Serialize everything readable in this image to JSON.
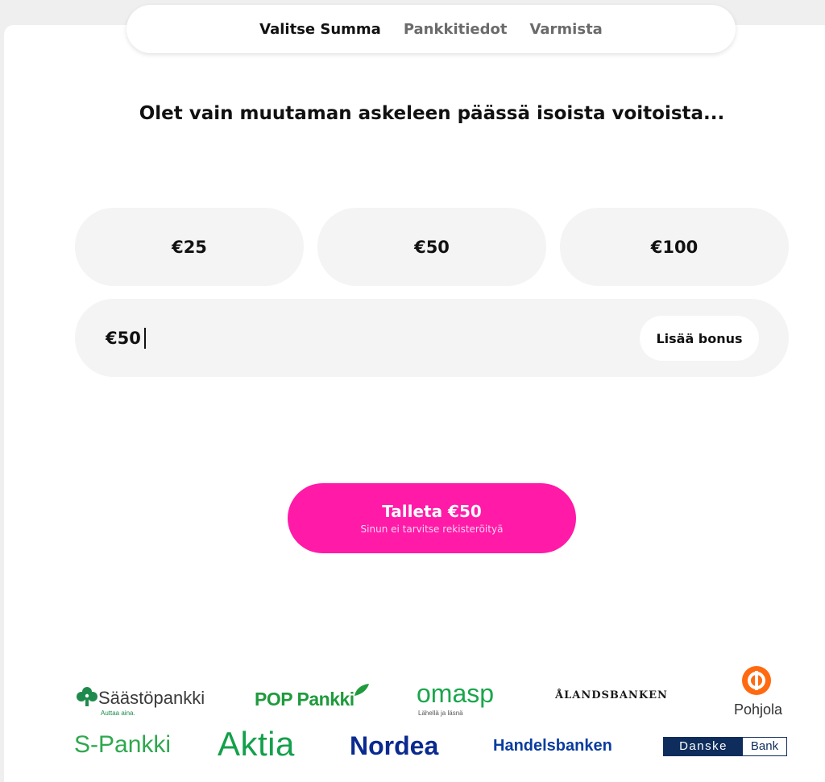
{
  "steps": [
    "Valitse Summa",
    "Pankkitiedot",
    "Varmista"
  ],
  "headline": "Olet vain muutaman askeleen päässä isoista voitoista...",
  "amount_options": [
    "€25",
    "€50",
    "€100"
  ],
  "amount_input": {
    "value": "€50"
  },
  "bonus_button": "Lisää bonus",
  "deposit_button": {
    "label": "Talleta €50",
    "sublabel": "Sinun ei tarvitse rekisteröityä"
  },
  "banks": {
    "saastopankki": {
      "name": "Säästöpankki",
      "tagline": "Auttaa aina."
    },
    "poppankki": {
      "name": "POP Pankki"
    },
    "omasp": {
      "name": "omasp",
      "tagline": "Lähellä ja läsnä"
    },
    "alandsbanken": {
      "name": "ÅLANDSBANKEN"
    },
    "pohjola": {
      "name": "Pohjola"
    },
    "spankki": {
      "name": "S-Pankki"
    },
    "aktia": {
      "name": "Aktia"
    },
    "nordea": {
      "name": "Nordea"
    },
    "handelsbanken": {
      "name": "Handelsbanken"
    },
    "danske": {
      "part1": "Danske",
      "part2": "Bank"
    }
  },
  "colors": {
    "accent": "#ff1aa8",
    "saastopankki": "#1e8a4c",
    "poppankki": "#1f9a3c",
    "omasp": "#1aa64c",
    "alandsbanken": "#1a1a1a",
    "pohjola": "#ff6a10",
    "spankki": "#2fa84f",
    "aktia": "#13a04a",
    "nordea": "#0a2a8f",
    "handelsbanken": "#0a3c9e",
    "danske": "#0e2d5c"
  }
}
